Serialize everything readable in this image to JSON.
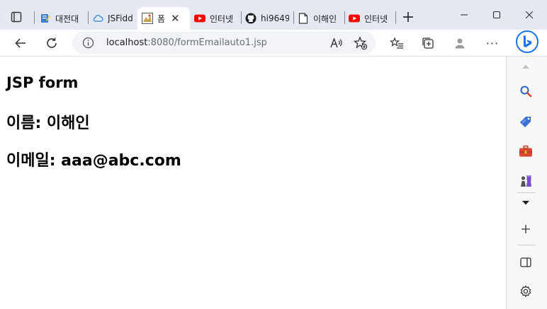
{
  "browser": {
    "tabs": [
      {
        "label": "대전대",
        "icon": "notepad-icon"
      },
      {
        "label": "JSFiddl",
        "icon": "jsfiddle-cloud-icon"
      },
      {
        "label": "폼",
        "icon": "page-thumbnail-icon",
        "active": true
      },
      {
        "label": "인터넷",
        "icon": "youtube-icon"
      },
      {
        "label": "hi9649",
        "icon": "github-icon"
      },
      {
        "label": "이해인",
        "icon": "document-icon"
      },
      {
        "label": "인터넷",
        "icon": "youtube-icon"
      }
    ],
    "address": {
      "host": "localhost",
      "path": ":8080/formEmailauto1.jsp"
    }
  },
  "page": {
    "heading": "JSP form",
    "name_line": "이름: 이해인",
    "email_line": "이메일: aaa@abc.com"
  },
  "colors": {
    "titlebar": "#e4e8f0",
    "youtube": "#ff0000",
    "bing_blue": "#1a73e8"
  }
}
